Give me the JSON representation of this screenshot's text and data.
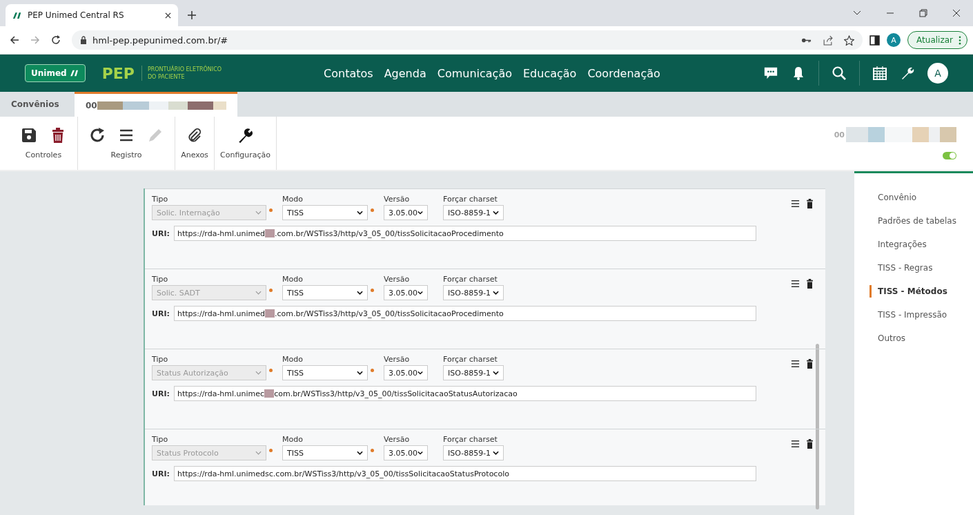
{
  "browser": {
    "tab_title": "PEP Unimed Central RS",
    "url": "hml-pep.pepunimed.com.br/#",
    "profile_initial": "A",
    "update_button": "Atualizar"
  },
  "header": {
    "logo": "Unimed",
    "app_name": "PEP",
    "subtitle_1": "PRONTUÁRIO ELETRÔNICO",
    "subtitle_2": "DO PACIENTE",
    "nav": [
      "Contatos",
      "Agenda",
      "Comunicação",
      "Educação",
      "Coordenação"
    ],
    "avatar": "A"
  },
  "tabs": [
    {
      "label": "Convênios",
      "selected": false,
      "redacted": false
    },
    {
      "label": "00",
      "selected": true,
      "redacted": true
    }
  ],
  "toolbar": [
    {
      "label": "Controles",
      "tools": [
        {
          "kind": "save",
          "disabled": false
        },
        {
          "kind": "trash",
          "disabled": false
        }
      ]
    },
    {
      "label": "Registro",
      "tools": [
        {
          "kind": "refresh",
          "disabled": false
        },
        {
          "kind": "list",
          "disabled": false
        },
        {
          "kind": "pencil",
          "disabled": true
        }
      ]
    },
    {
      "label": "Anexos",
      "tools": [
        {
          "kind": "clip",
          "disabled": false
        }
      ]
    },
    {
      "label": "Configuração",
      "tools": [
        {
          "kind": "wrench",
          "disabled": false
        }
      ]
    }
  ],
  "record": {
    "code": "00",
    "active": true
  },
  "methods": [
    {
      "tipo_label": "Tipo",
      "modo_label": "Modo",
      "versao_label": "Versão",
      "charset_label": "Forçar charset",
      "uri_label": "URI:",
      "tipo": "Solic. Internação",
      "modo": "TISS",
      "versao": "3.05.00",
      "charset": "ISO-8859-1",
      "uri_start": "https://rda-hml.unimed",
      "redacted": true,
      "uri_end": ".com.br/WSTiss3/http/v3_05_00/tissSolicitacaoProcedimento"
    },
    {
      "tipo_label": "Tipo",
      "modo_label": "Modo",
      "versao_label": "Versão",
      "charset_label": "Forçar charset",
      "uri_label": "URI:",
      "tipo": "Solic. SADT",
      "modo": "TISS",
      "versao": "3.05.00",
      "charset": "ISO-8859-1",
      "uri_start": "https://rda-hml.unimed",
      "redacted": true,
      "uri_end": ".com.br/WSTiss3/http/v3_05_00/tissSolicitacaoProcedimento"
    },
    {
      "tipo_label": "Tipo",
      "modo_label": "Modo",
      "versao_label": "Versão",
      "charset_label": "Forçar charset",
      "uri_label": "URI:",
      "tipo": "Status Autorização",
      "modo": "TISS",
      "versao": "3.05.00",
      "charset": "ISO-8859-1",
      "uri_start": "https://rda-hml.unimec",
      "redacted": true,
      "uri_end": "com.br/WSTiss3/http/v3_05_00/tissSolicitacaoStatusAutorizacao"
    },
    {
      "tipo_label": "Tipo",
      "modo_label": "Modo",
      "versao_label": "Versão",
      "charset_label": "Forçar charset",
      "uri_label": "URI:",
      "tipo": "Status Protocolo",
      "modo": "TISS",
      "versao": "3.05.00",
      "charset": "ISO-8859-1",
      "uri_start": "https://rda-hml.unimedsc.com.br/WSTiss3/http/v3_05_00/tissSolicitacaoStatusProtocolo",
      "redacted": false
    }
  ],
  "sidebar": [
    {
      "label": "Convênio",
      "selected": false
    },
    {
      "label": "Padrões de tabelas",
      "selected": false
    },
    {
      "label": "Integrações",
      "selected": false
    },
    {
      "label": "TISS - Regras",
      "selected": false
    },
    {
      "label": "TISS - Métodos",
      "selected": true
    },
    {
      "label": "TISS - Impressão",
      "selected": false
    },
    {
      "label": "Outros",
      "selected": false
    }
  ]
}
